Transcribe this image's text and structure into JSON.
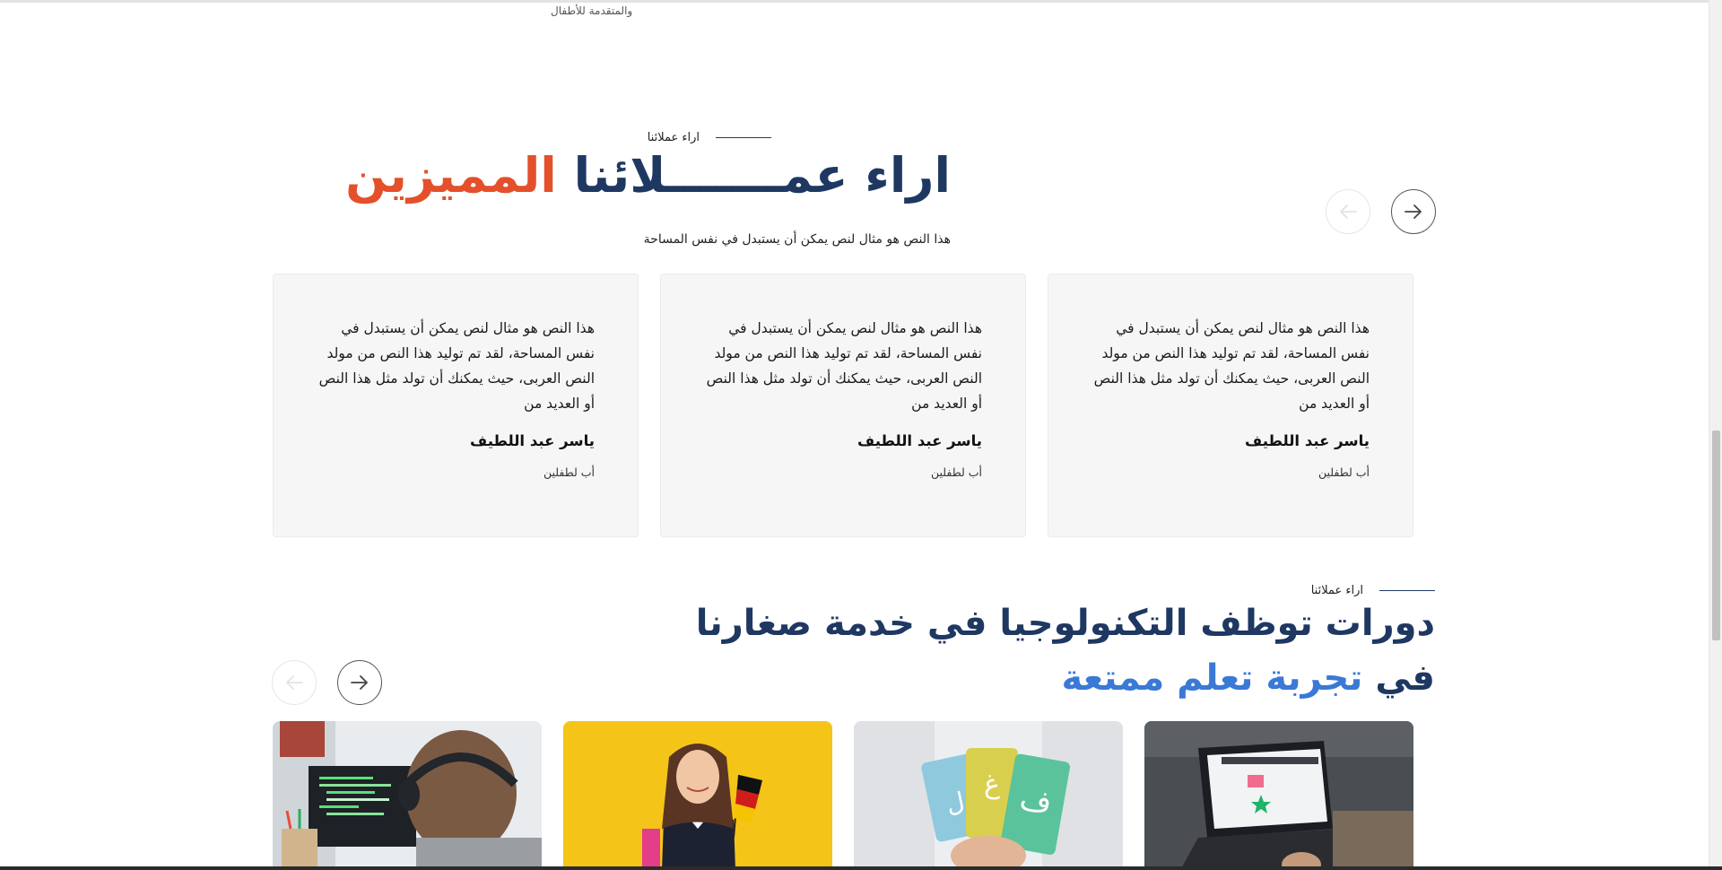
{
  "top_fragment": "والمتقدمة للأطفال",
  "testimonials": {
    "eyebrow": "اراء عملائنا",
    "title_dark": "اراء عمـــــــلائنا",
    "title_accent": "المميزين",
    "subtitle": "هذا النص هو مثال لنص يمكن أن يستبدل في نفس المساحة",
    "cards": [
      {
        "quote": "هذا النص هو مثال لنص يمكن أن يستبدل في نفس المساحة، لقد تم توليد هذا النص من مولد النص العربى، حيث يمكنك أن تولد مثل هذا النص أو العديد من",
        "name": "ياسر عبد اللطيف",
        "role": "أب لطفلين"
      },
      {
        "quote": "هذا النص هو مثال لنص يمكن أن يستبدل في نفس المساحة، لقد تم توليد هذا النص من مولد النص العربى، حيث يمكنك أن تولد مثل هذا النص أو العديد من",
        "name": "ياسر عبد اللطيف",
        "role": "أب لطفلين"
      },
      {
        "quote": "هذا النص هو مثال لنص يمكن أن يستبدل في نفس المساحة، لقد تم توليد هذا النص من مولد النص العربى، حيث يمكنك أن تولد مثل هذا النص أو العديد من",
        "name": "ياسر عبد اللطيف",
        "role": "أب لطفلين"
      }
    ]
  },
  "courses": {
    "eyebrow": "اراء عملائنا",
    "title_line1": "دورات توظف التكنولوجيا في خدمة صغارنا",
    "title_line2_dark": "في",
    "title_line2_accent": "تجربة تعلم ممتعة",
    "images": [
      "laptop-design-photo",
      "arabic-letter-cards-photo",
      "girl-with-flag-photo",
      "child-coding-photo"
    ],
    "letters": {
      "left": "ل",
      "middle": "غ",
      "right": "ف"
    }
  },
  "colors": {
    "navy": "#1e3862",
    "orange": "#e4502b",
    "blue": "#3a79d6"
  }
}
